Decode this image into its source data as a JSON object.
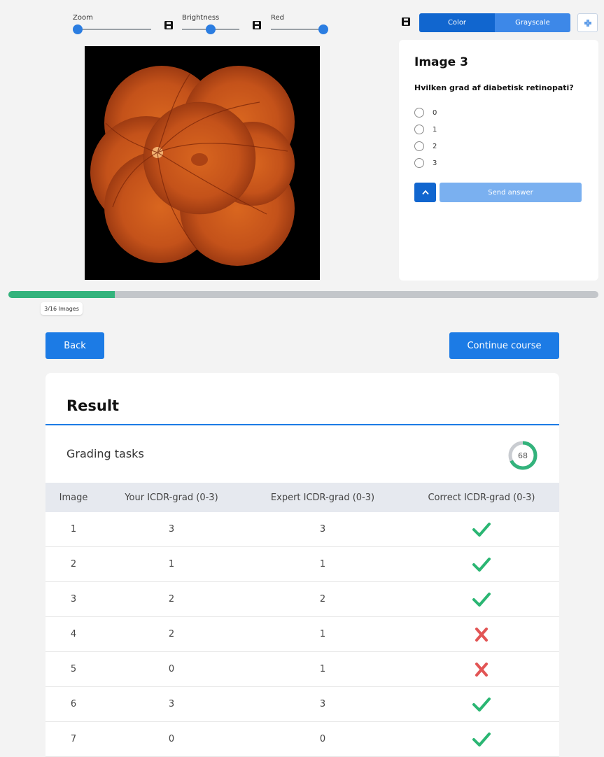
{
  "controls": {
    "zoom_label": "Zoom",
    "brightness_label": "Brightness",
    "red_label": "Red"
  },
  "mode": {
    "color_label": "Color",
    "grayscale_label": "Grayscale",
    "active": "Color"
  },
  "question": {
    "title": "Image 3",
    "text": "Hvilken grad af diabetisk retinopati?",
    "options": [
      "0",
      "1",
      "2",
      "3"
    ],
    "send_label": "Send answer"
  },
  "progress": {
    "label": "3/16 Images",
    "fraction": 0.18
  },
  "nav": {
    "back_label": "Back",
    "continue_label": "Continue course"
  },
  "result": {
    "title": "Result",
    "grading_label": "Grading tasks",
    "score": "68",
    "score_fraction": 0.68,
    "columns": [
      "Image",
      "Your ICDR-grad (0-3)",
      "Expert ICDR-grad (0-3)",
      "Correct ICDR-grad (0-3)"
    ],
    "rows": [
      {
        "image": "1",
        "yours": "3",
        "expert": "3",
        "correct": true
      },
      {
        "image": "2",
        "yours": "1",
        "expert": "1",
        "correct": true
      },
      {
        "image": "3",
        "yours": "2",
        "expert": "2",
        "correct": true
      },
      {
        "image": "4",
        "yours": "2",
        "expert": "1",
        "correct": false
      },
      {
        "image": "5",
        "yours": "0",
        "expert": "1",
        "correct": false
      },
      {
        "image": "6",
        "yours": "3",
        "expert": "3",
        "correct": true
      },
      {
        "image": "7",
        "yours": "0",
        "expert": "0",
        "correct": true
      }
    ]
  },
  "colors": {
    "primary": "#1c7be5",
    "progress": "#33b37c",
    "check": "#2bb673",
    "cross": "#e25555"
  }
}
